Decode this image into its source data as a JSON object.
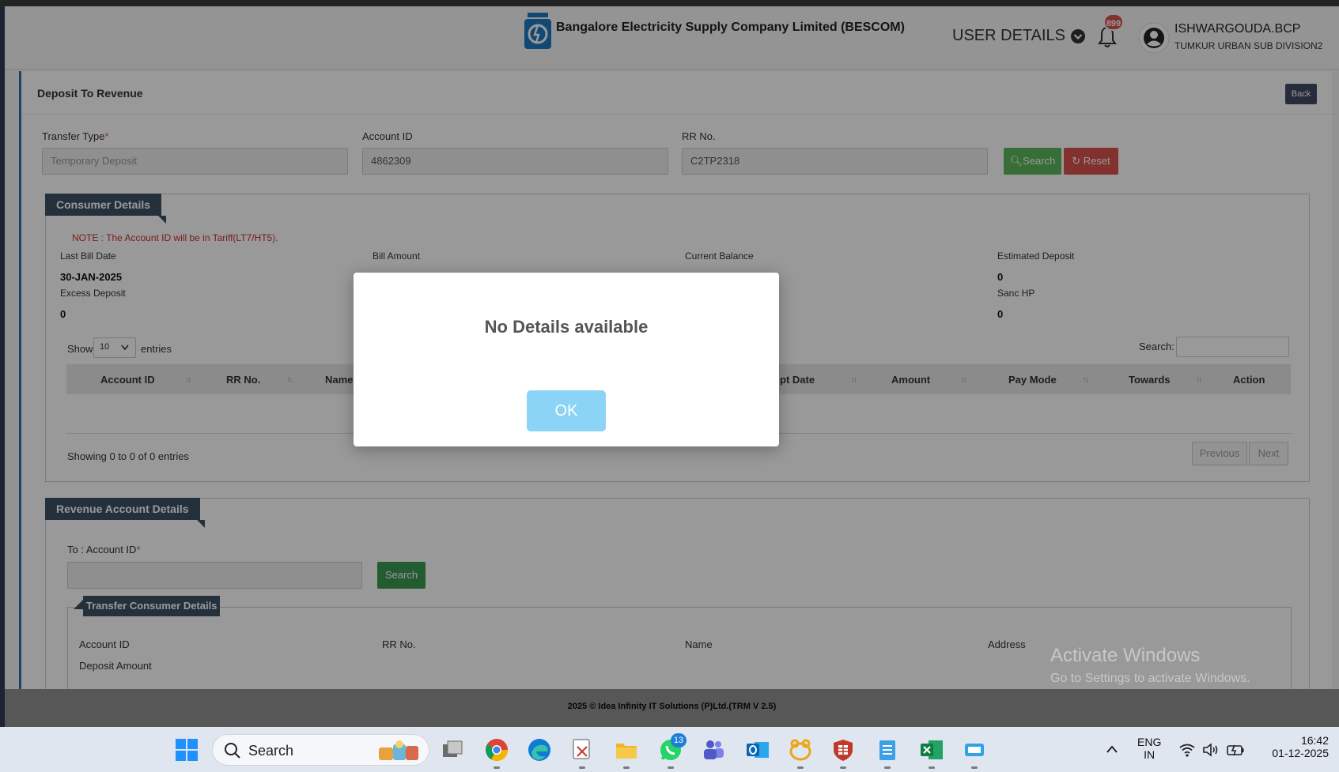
{
  "header": {
    "company": "Bangalore Electricity Supply Company Limited (BESCOM)",
    "user_details": "USER DETAILS",
    "notification_count": "899",
    "username": "ISHWARGOUDA.BCP",
    "subdivision": "TUMKUR URBAN SUB DIVISION2"
  },
  "page": {
    "title": "Deposit To Revenue",
    "back": "Back"
  },
  "form": {
    "transfer_type_label": "Transfer Type",
    "transfer_type_placeholder": "Temporary Deposit",
    "account_id_label": "Account ID",
    "account_id_value": "4862309",
    "rr_label": "RR No.",
    "rr_value": "C2TP2318",
    "search": "Search",
    "reset": "Reset",
    "req": "*"
  },
  "consumer": {
    "legend": "Consumer Details",
    "note": "NOTE : The Account ID will be in Tariff(LT7/HT5).",
    "last_bill_date_label": "Last Bill Date",
    "last_bill_date": "30-JAN-2025",
    "bill_amount_label": "Bill Amount",
    "current_balance_label": "Current Balance",
    "estimated_deposit_label": "Estimated Deposit",
    "estimated_deposit": "0",
    "excess_deposit_label": "Excess Deposit",
    "excess_deposit": "0",
    "sanc_hp_label": "Sanc HP",
    "sanc_hp": "0"
  },
  "table": {
    "show": "Show",
    "entries_value": "10",
    "entries": "entries",
    "search_label": "Search:",
    "columns": [
      "Account ID",
      "RR No.",
      "Name",
      "pt Date",
      "Amount",
      "Pay Mode",
      "Towards",
      "Action"
    ],
    "showing": "Showing 0 to 0 of 0 entries",
    "previous": "Previous",
    "next": "Next"
  },
  "revenue": {
    "legend": "Revenue Account Details",
    "to_account_label": "To : Account ID",
    "search": "Search",
    "transfer_legend": "Transfer Consumer Details",
    "account_id": "Account ID",
    "rr_no": "RR No.",
    "name": "Name",
    "address": "Address",
    "deposit_amount": "Deposit Amount"
  },
  "modal": {
    "title": "No Details available",
    "ok": "OK"
  },
  "footer": "2025 © Idea Infinity IT Solutions (P)Ltd.(TRM V 2.5)",
  "watermark": {
    "line1": "Activate Windows",
    "line2": "Go to Settings to activate Windows."
  },
  "taskbar": {
    "search": "Search",
    "whatsapp_badge": "13",
    "lang1": "ENG",
    "lang2": "IN",
    "time": "16:42",
    "date": "01-12-2025"
  }
}
